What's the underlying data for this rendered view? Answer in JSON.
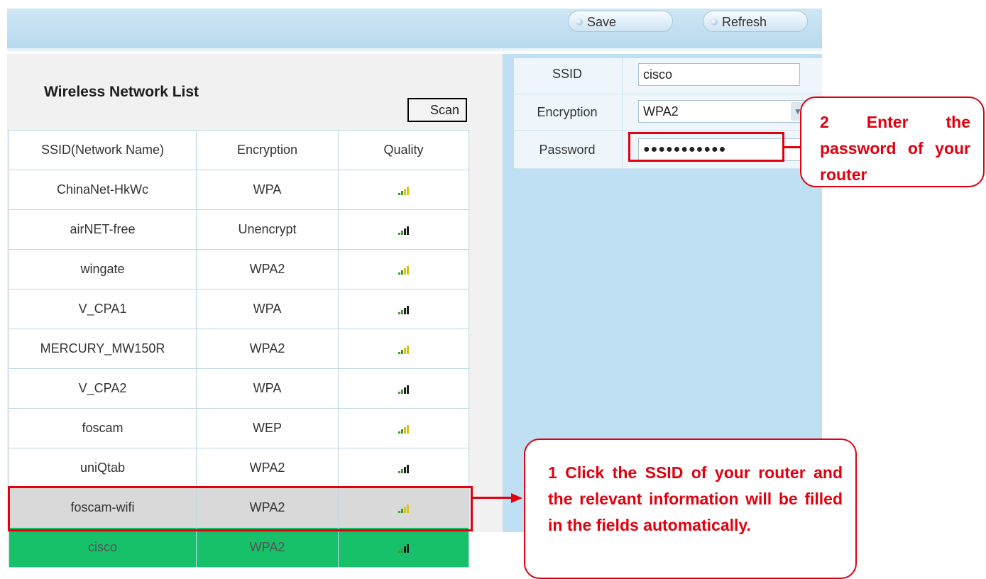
{
  "toolbar": {
    "save_label": "Save",
    "refresh_label": "Refresh"
  },
  "wireless_list": {
    "title": "Wireless Network List",
    "scan_label": "Scan",
    "columns": [
      "SSID(Network Name)",
      "Encryption",
      "Quality"
    ],
    "rows": [
      {
        "ssid": "ChinaNet-HkWc",
        "encryption": "WPA",
        "quality_icon": "signal-bars-icon",
        "state": "normal"
      },
      {
        "ssid": "airNET-free",
        "encryption": "Unencrypt",
        "quality_icon": "signal-bars-icon",
        "state": "normal"
      },
      {
        "ssid": "wingate",
        "encryption": "WPA2",
        "quality_icon": "signal-bars-icon",
        "state": "normal"
      },
      {
        "ssid": "V_CPA1",
        "encryption": "WPA",
        "quality_icon": "signal-bars-icon",
        "state": "normal"
      },
      {
        "ssid": "MERCURY_MW150R",
        "encryption": "WPA2",
        "quality_icon": "signal-bars-icon",
        "state": "normal"
      },
      {
        "ssid": "V_CPA2",
        "encryption": "WPA",
        "quality_icon": "signal-bars-icon",
        "state": "normal"
      },
      {
        "ssid": "foscam",
        "encryption": "WEP",
        "quality_icon": "signal-bars-icon",
        "state": "normal"
      },
      {
        "ssid": "uniQtab",
        "encryption": "WPA2",
        "quality_icon": "signal-bars-icon",
        "state": "normal"
      },
      {
        "ssid": "foscam-wifi",
        "encryption": "WPA2",
        "quality_icon": "signal-bars-icon",
        "state": "hover"
      },
      {
        "ssid": "cisco",
        "encryption": "WPA2",
        "quality_icon": "signal-bars-icon",
        "state": "selected"
      }
    ]
  },
  "form": {
    "ssid_label": "SSID",
    "ssid_value": "cisco",
    "encryption_label": "Encryption",
    "encryption_value": "WPA2",
    "password_label": "Password",
    "password_value": "●●●●●●●●●●●"
  },
  "annotations": {
    "step2": "2 Enter the password of your router",
    "step1": "1 Click the SSID of your router and the relevant information will be filled in the fields automatically."
  },
  "colors": {
    "accent_red": "#e1000f",
    "selected_row": "#16c16a",
    "panel_blue": "#bfe0f2",
    "signal_green": "#3a9a2e",
    "signal_yellow": "#d9c21a"
  }
}
